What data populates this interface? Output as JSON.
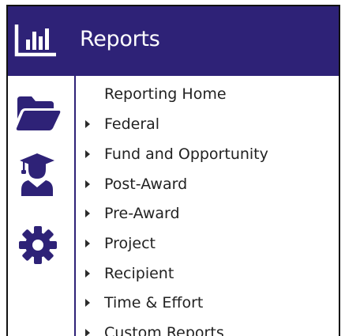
{
  "header": {
    "title": "Reports",
    "icon": "bar-chart-icon",
    "background": "#2e2277"
  },
  "rail": {
    "items": [
      {
        "icon": "folder-open-icon"
      },
      {
        "icon": "graduate-user-icon"
      },
      {
        "icon": "gear-icon"
      }
    ],
    "icon_color": "#2e2277"
  },
  "menu": {
    "items": [
      {
        "label": "Reporting Home",
        "expandable": false
      },
      {
        "label": "Federal",
        "expandable": true
      },
      {
        "label": "Fund and Opportunity",
        "expandable": true
      },
      {
        "label": "Post-Award",
        "expandable": true
      },
      {
        "label": "Pre-Award",
        "expandable": true
      },
      {
        "label": "Project",
        "expandable": true
      },
      {
        "label": "Recipient",
        "expandable": true
      },
      {
        "label": "Time & Effort",
        "expandable": true
      },
      {
        "label": "Custom Reports",
        "expandable": true
      }
    ]
  }
}
